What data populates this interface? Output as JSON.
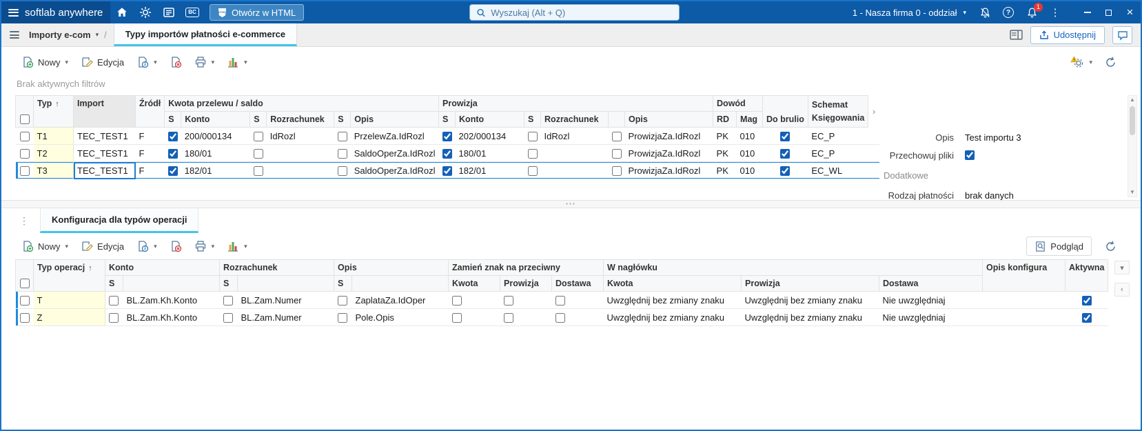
{
  "colors": {
    "topbar": "#0d5aa7",
    "accent": "#1565c0",
    "tab_underline": "#42c5e8",
    "selection": "#1e8be0",
    "notification_badge": "#e53935",
    "key_column": "#ffffdf",
    "warning": "#f5c431"
  },
  "icons": {
    "caret_down": "▾",
    "sort_asc": "↑",
    "chevron_right": "›",
    "chevron_left": "‹",
    "kebab": "⋮",
    "drag_dots": "⋮",
    "splitter_dots": "⋯",
    "help": "?",
    "close": "×",
    "scroll_up": "▲",
    "scroll_down": "▼",
    "breadcrumb_separator": "/"
  },
  "topbar": {
    "app_name": "softlab anywhere",
    "bc_label": "BC",
    "open_html_label": "Otwórz w HTML",
    "search_placeholder": "Wyszukaj (Alt + Q)",
    "company_selector": "1 - Nasza firma 0 - oddział",
    "notification_count": "1"
  },
  "upper": {
    "breadcrumb": "Importy e-com",
    "tab": "Typy importów płatności e-commerce",
    "share_label": "Udostępnij",
    "toolbar": {
      "new": "Nowy",
      "edit": "Edycja"
    },
    "filters_info": "Brak aktywnych filtrów"
  },
  "grid1": {
    "headers": {
      "typ": "Typ",
      "import": "Import",
      "zrodlo": "Źródł",
      "kwota_group": "Kwota przelewu / saldo",
      "prowizja_group": "Prowizja",
      "dowod_group": "Dowód",
      "s": "S",
      "konto": "Konto",
      "rozrachunek": "Rozrachunek",
      "opis": "Opis",
      "rd": "RD",
      "mag": "Mag",
      "do_brulionu": "Do brulio",
      "schemat_ksiegowania": "Schemat Księgowania"
    },
    "rows": [
      {
        "typ": "T1",
        "import": "TEC_TEST1",
        "zrodlo": "F",
        "kwota_s": true,
        "kwota_konto": "200/000134",
        "kwota_rozrachunek_s": false,
        "kwota_rozrachunek": "IdRozl",
        "kwota_opis_s": false,
        "kwota_opis": "PrzelewZa.IdRozl",
        "prowizja_s": true,
        "prowizja_konto": "202/000134",
        "prowizja_rozrachunek_s": false,
        "prowizja_rozrachunek": "IdRozl",
        "prowizja_opis_s": false,
        "prowizja_opis": "ProwizjaZa.IdRozl",
        "rd": "PK",
        "mag": "010",
        "do_brulionu": true,
        "schemat": "EC_P"
      },
      {
        "typ": "T2",
        "import": "TEC_TEST1",
        "zrodlo": "F",
        "kwota_s": true,
        "kwota_konto": "180/01",
        "kwota_rozrachunek_s": false,
        "kwota_rozrachunek": "",
        "kwota_opis_s": false,
        "kwota_opis": "SaldoOperZa.IdRozl",
        "prowizja_s": true,
        "prowizja_konto": "180/01",
        "prowizja_rozrachunek_s": false,
        "prowizja_rozrachunek": "",
        "prowizja_opis_s": false,
        "prowizja_opis": "ProwizjaZa.IdRozl",
        "rd": "PK",
        "mag": "010",
        "do_brulionu": true,
        "schemat": "EC_P"
      },
      {
        "typ": "T3",
        "import": "TEC_TEST1",
        "zrodlo": "F",
        "kwota_s": true,
        "kwota_konto": "182/01",
        "kwota_rozrachunek_s": false,
        "kwota_rozrachunek": "",
        "kwota_opis_s": false,
        "kwota_opis": "SaldoOperZa.IdRozl",
        "prowizja_s": true,
        "prowizja_konto": "182/01",
        "prowizja_rozrachunek_s": false,
        "prowizja_rozrachunek": "",
        "prowizja_opis_s": false,
        "prowizja_opis": "ProwizjaZa.IdRozl",
        "rd": "PK",
        "mag": "010",
        "do_brulionu": true,
        "schemat": "EC_WL"
      }
    ]
  },
  "detail": {
    "opis_label": "Opis",
    "opis_value": "Test importu 3",
    "przechowuj_label": "Przechowuj pliki",
    "przechowuj_checked": true,
    "section_label": "Dodatkowe",
    "rodzaj_label": "Rodzaj płatności",
    "rodzaj_value": "brak danych"
  },
  "lower": {
    "tab": "Konfiguracja dla typów operacji",
    "toolbar": {
      "new": "Nowy",
      "edit": "Edycja",
      "preview": "Podgląd"
    }
  },
  "grid2": {
    "headers": {
      "typ_operacji": "Typ operacj",
      "konto": "Konto",
      "rozrachunek": "Rozrachunek",
      "opis": "Opis",
      "s": "S",
      "zamien_group": "Zamień znak na przeciwny",
      "naglowek_group": "W nagłówku",
      "kwota": "Kwota",
      "prowizja": "Prowizja",
      "dostawa": "Dostawa",
      "opis_konfiguracji": "Opis konfigura",
      "aktywna": "Aktywna"
    },
    "rows": [
      {
        "typ": "T",
        "konto_s": false,
        "konto": "BL.Zam.Kh.Konto",
        "rozrachunek_s": false,
        "rozrachunek": "BL.Zam.Numer",
        "opis_s": false,
        "opis": "ZaplataZa.IdOper",
        "zamien_kwota": false,
        "zamien_prowizja": false,
        "zamien_dostawa": false,
        "naglowek_kwota": "Uwzględnij bez zmiany znaku",
        "naglowek_prowizja": "Uwzględnij bez zmiany znaku",
        "naglowek_dostawa": "Nie uwzględniaj",
        "opis_konfiguracji": "",
        "aktywna": true
      },
      {
        "typ": "Z",
        "konto_s": false,
        "konto": "BL.Zam.Kh.Konto",
        "rozrachunek_s": false,
        "rozrachunek": "BL.Zam.Numer",
        "opis_s": false,
        "opis": "Pole.Opis",
        "zamien_kwota": false,
        "zamien_prowizja": false,
        "zamien_dostawa": false,
        "naglowek_kwota": "Uwzględnij bez zmiany znaku",
        "naglowek_prowizja": "Uwzględnij bez zmiany znaku",
        "naglowek_dostawa": "Nie uwzględniaj",
        "opis_konfiguracji": "",
        "aktywna": true
      }
    ]
  }
}
